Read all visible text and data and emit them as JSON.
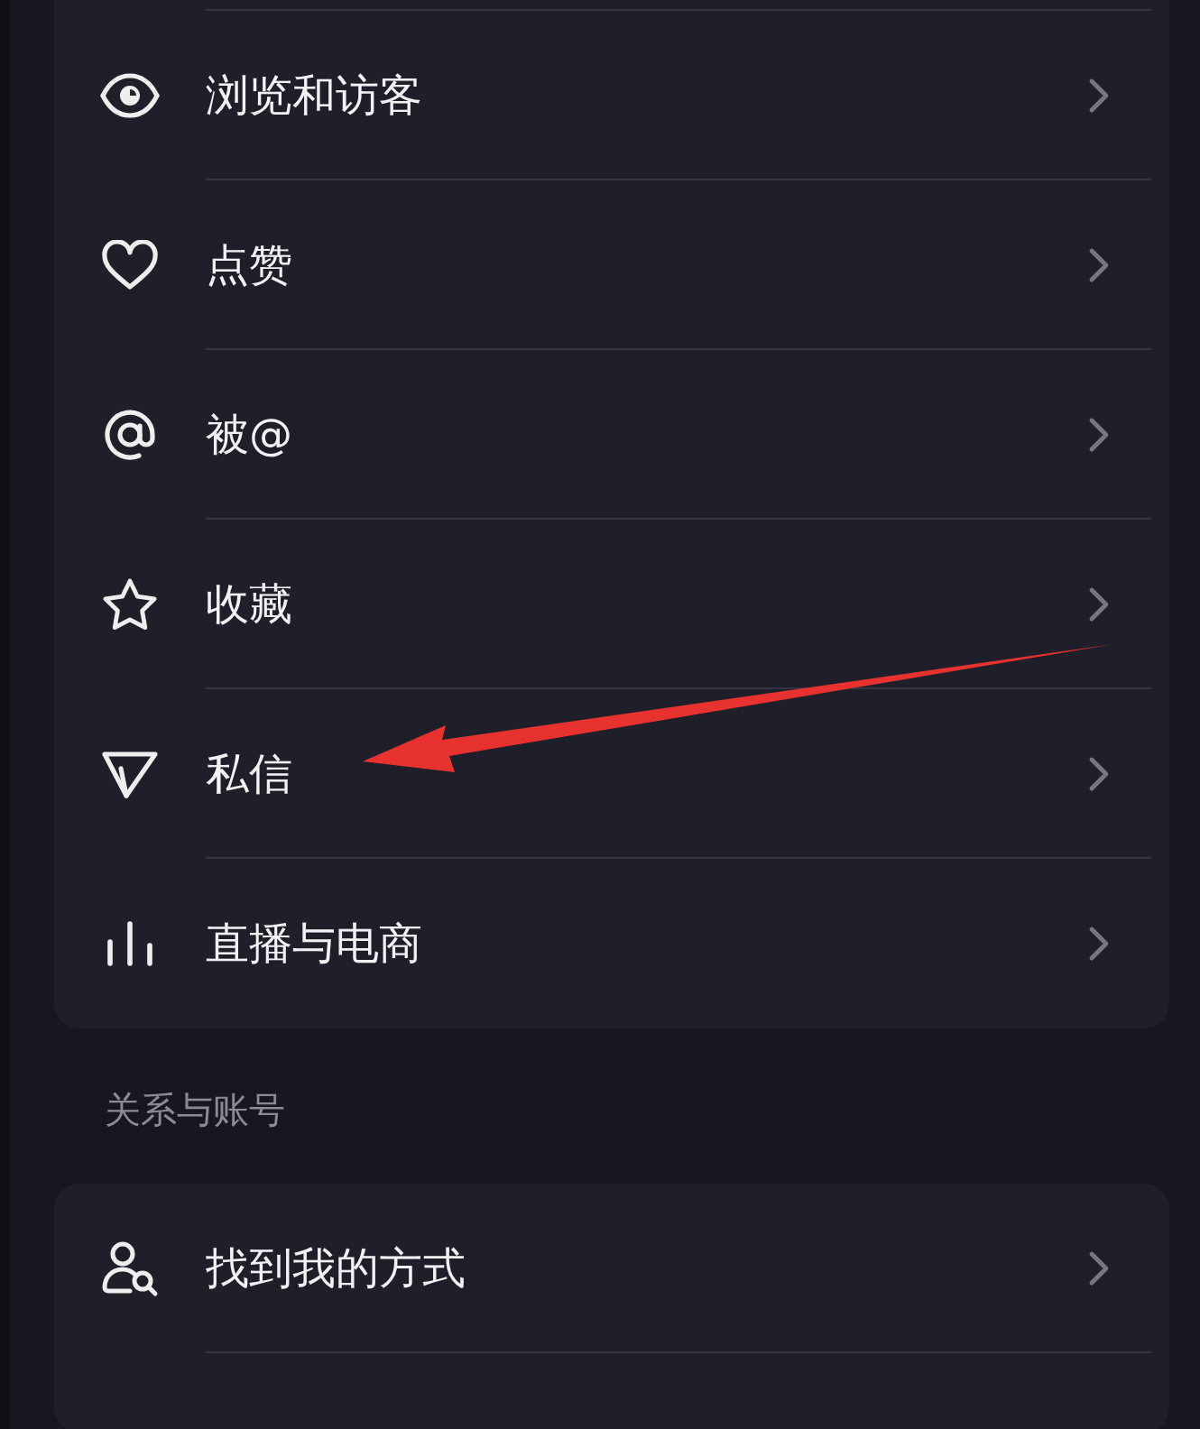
{
  "sections": [
    {
      "items": [
        {
          "kind": "eye",
          "label": "浏览和访客"
        },
        {
          "kind": "heart",
          "label": "点赞"
        },
        {
          "kind": "at",
          "label": "被@"
        },
        {
          "kind": "star",
          "label": "收藏"
        },
        {
          "kind": "send",
          "label": "私信"
        },
        {
          "kind": "bars",
          "label": "直播与电商"
        }
      ]
    },
    {
      "header": "关系与账号",
      "items": [
        {
          "kind": "person-search",
          "label": "找到我的方式"
        }
      ]
    }
  ],
  "annotation": {
    "kind": "arrow"
  }
}
